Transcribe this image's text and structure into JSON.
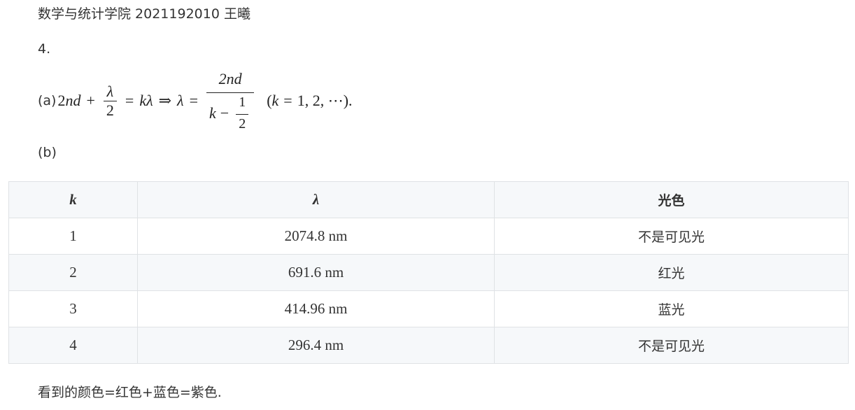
{
  "header": {
    "line": "数学与统计学院 2021192010 王曦"
  },
  "problem": {
    "number": "4."
  },
  "part_a": {
    "label": "(a)",
    "lhs_1": "2",
    "lhs_n": "n",
    "lhs_d": "d",
    "plus": "+",
    "half_lambda_num": "λ",
    "half_lambda_den": "2",
    "eq1": "=",
    "k": "k",
    "lambda": "λ",
    "implies": "⇒",
    "lambda2": "λ",
    "eq2": "=",
    "frac_num": "2nd",
    "frac_den_k": "k",
    "frac_den_minus": "−",
    "frac_den_half_num": "1",
    "frac_den_half_den": "2",
    "range_open": "(",
    "range_k": "k",
    "range_eq": "=",
    "range_vals": "1, 2, ⋯",
    "range_close": ").",
    "range_full": "(k = 1, 2, ⋯)."
  },
  "part_b": {
    "label": "(b)"
  },
  "table": {
    "headers": {
      "k": "k",
      "lambda": "λ",
      "color": "光色"
    },
    "rows": [
      {
        "k": "1",
        "lambda": "2074.8 nm",
        "color": "不是可见光"
      },
      {
        "k": "2",
        "lambda": "691.6 nm",
        "color": "红光"
      },
      {
        "k": "3",
        "lambda": "414.96 nm",
        "color": "蓝光"
      },
      {
        "k": "4",
        "lambda": "296.4 nm",
        "color": "不是可见光"
      }
    ]
  },
  "conclusion": {
    "text": "看到的颜色=红色+蓝色=紫色."
  }
}
